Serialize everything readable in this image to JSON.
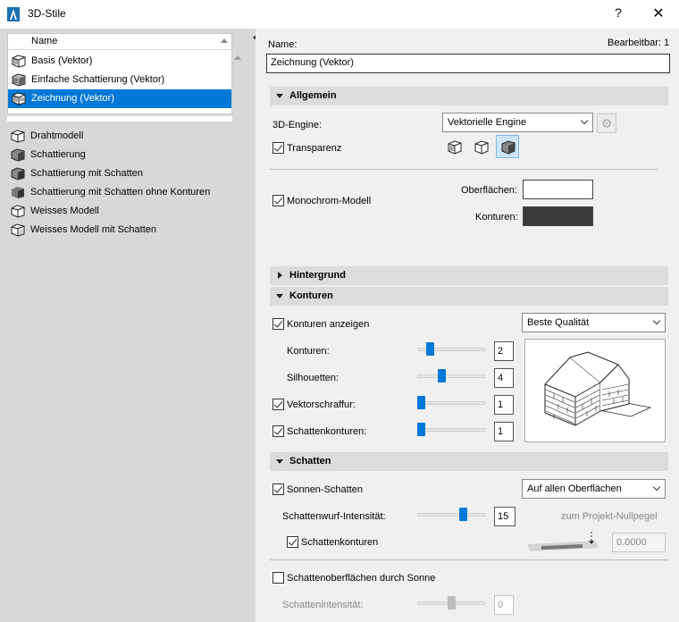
{
  "window": {
    "title": "3D-Stile",
    "help_label": "?",
    "close_label": "✕",
    "app_icon": "archicad-icon"
  },
  "list": {
    "header": "Name",
    "items": [
      {
        "label": "Basis (Vektor)",
        "icon": "vector-cube-icon"
      },
      {
        "label": "Einfache Schattierung (Vektor)",
        "icon": "shaded-vector-icon"
      },
      {
        "label": "Zeichnung (Vektor)",
        "icon": "drawing-vector-icon",
        "selected": true
      }
    ],
    "standard_items": [
      {
        "label": "Drahtmodell",
        "icon": "wireframe-icon"
      },
      {
        "label": "Schattierung",
        "icon": "shading-icon"
      },
      {
        "label": "Schattierung mit Schatten",
        "icon": "shading-shadow-icon"
      },
      {
        "label": "Schattierung mit Schatten ohne Konturen",
        "icon": "shading-shadow-nocontour-icon"
      },
      {
        "label": "Weisses Modell",
        "icon": "white-model-icon"
      },
      {
        "label": "Weisses Modell mit Schatten",
        "icon": "white-model-shadow-icon"
      }
    ]
  },
  "details": {
    "name_label": "Name:",
    "editable_label": "Bearbeitbar: 1",
    "name_value": "Zeichnung (Vektor)",
    "general": {
      "title": "Allgemein",
      "engine_label": "3D-Engine:",
      "engine_value": "Vektorielle Engine",
      "transparency_label": "Transparenz",
      "transparency_checked": true,
      "monochrome_label": "Monochrom-Modell",
      "monochrome_checked": true,
      "surfaces_label": "Oberflächen:",
      "surfaces_color": "#ffffff",
      "contours_label": "Konturen:",
      "contours_color": "#3a3a3a"
    },
    "background": {
      "title": "Hintergrund"
    },
    "contours": {
      "title": "Konturen",
      "show_label": "Konturen anzeigen",
      "show_checked": true,
      "quality_value": "Beste Qualität",
      "contours_label": "Konturen:",
      "contours_value": "2",
      "contours_level": 0.15,
      "silhouettes_label": "Silhouetten:",
      "silhouettes_value": "4",
      "silhouettes_level": 0.35,
      "vector_hatch_label": "Vektorschraffur:",
      "vector_hatch_checked": true,
      "vector_hatch_value": "1",
      "vector_hatch_level": 0.0,
      "shadow_contours_label": "Schattenkonturen:",
      "shadow_contours_checked": true,
      "shadow_contours_value": "1",
      "shadow_contours_level": 0.0
    },
    "shadows": {
      "title": "Schatten",
      "sun_label": "Sonnen-Schatten",
      "sun_checked": true,
      "surfaces_value": "Auf allen Oberflächen",
      "intensity_label": "Schattenwurf-Intensität:",
      "intensity_value": "15",
      "intensity_level": 0.7,
      "nullpegel_label": "zum Projekt-Nullpegel",
      "nullpegel_value": "0.0000",
      "shadow_contours_label": "Schattenkonturen",
      "shadow_contours_checked": true,
      "sun_surfaces_label": "Schattenoberflächen durch Sonne",
      "sun_surfaces_checked": false,
      "shadow_intensity_label": "Schattenintensität:",
      "shadow_intensity_value": "0",
      "shadow_intensity_level": 0.5
    }
  },
  "colors": {
    "selection": "#0078d7",
    "slider_thumb": "#0078d7"
  }
}
